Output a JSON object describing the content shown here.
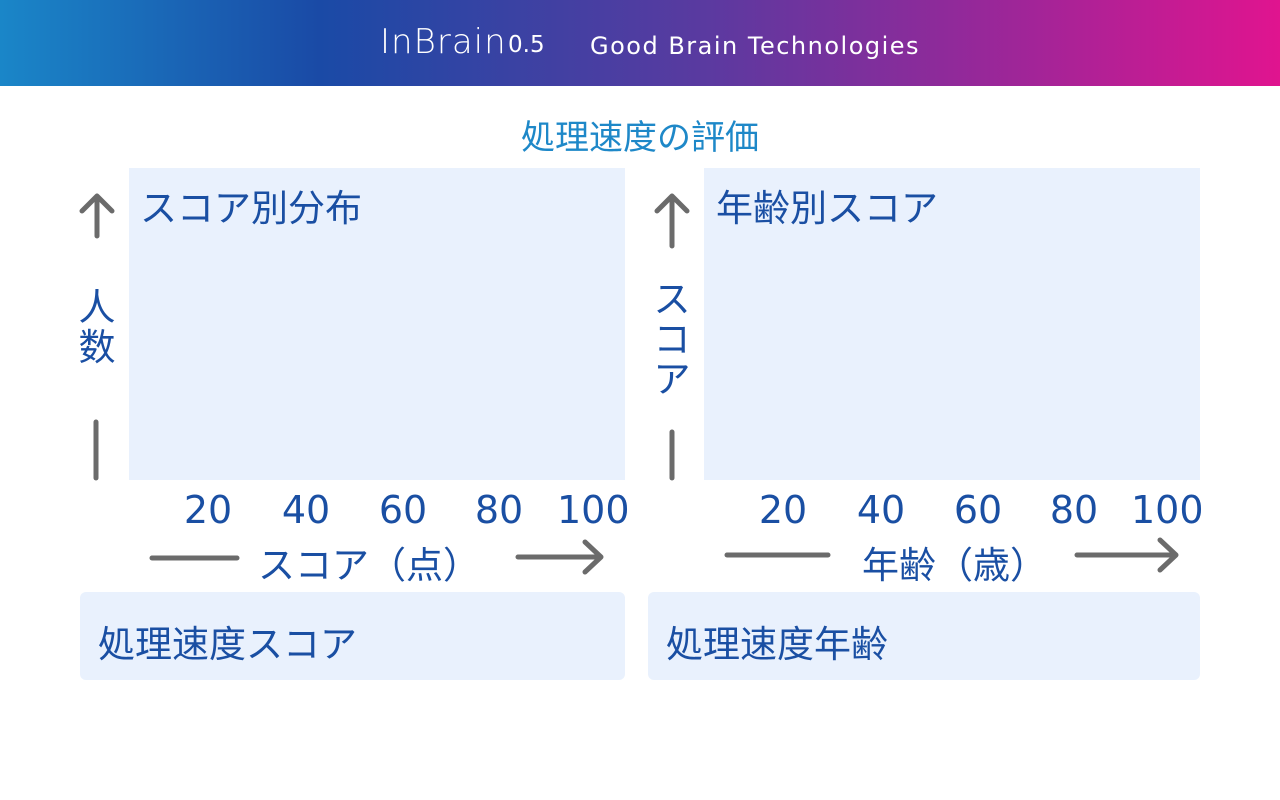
{
  "header": {
    "app_name": "InBrain",
    "version": "0.5",
    "company": "Good Brain Technologies"
  },
  "page_title": "処理速度の評価",
  "charts": [
    {
      "title": "スコア別分布",
      "ylabel": "人数",
      "xlabel": "スコア（点）",
      "xticks": [
        "20",
        "40",
        "60",
        "80",
        "100"
      ]
    },
    {
      "title": "年齢別スコア",
      "ylabel": "スコア",
      "xlabel": "年齢（歳）",
      "xticks": [
        "20",
        "40",
        "60",
        "80",
        "100"
      ]
    }
  ],
  "bottom": {
    "left_label": "処理速度スコア",
    "right_label": "処理速度年齢"
  },
  "colors": {
    "accent_blue": "#1a4fa3",
    "title_blue": "#1e88c8",
    "panel_bg": "#e9f1fd",
    "arrow_gray": "#6b6b6b"
  }
}
